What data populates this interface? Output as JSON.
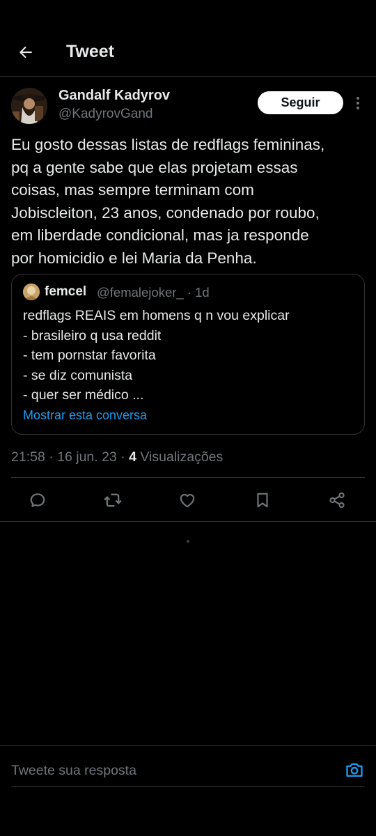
{
  "header": {
    "title": "Tweet",
    "back_icon": "arrow-left-icon"
  },
  "tweet": {
    "author_name": "Gandalf Kadyrov",
    "author_handle": "@KadyrovGand",
    "follow_label": "Seguir",
    "text": "Eu gosto dessas listas de redflags femininas,\npq a gente sabe que elas projetam essas\ncoisas, mas sempre terminam com\nJobiscleiton, 23 anos, condenado por roubo,\nem liberdade condicional, mas ja responde\npor homicidio e lei Maria da Penha.",
    "time": "21:58 · 16 jun. 23 · ",
    "views_count": "4",
    "views_label": " Visualizações"
  },
  "quote": {
    "author_name": "femcel",
    "author_handle": "@femalejoker_ · 1d",
    "text": "redflags REAIS em homens q n vou explicar\n- brasileiro q usa reddit\n- tem pornstar favorita\n- se diz comunista\n- quer ser médico ...",
    "link": "Mostrar esta conversa"
  },
  "actions": [
    {
      "icon": "reply-icon"
    },
    {
      "icon": "retweet-icon"
    },
    {
      "icon": "like-icon"
    },
    {
      "icon": "bookmark-icon"
    },
    {
      "icon": "share-icon"
    }
  ],
  "reply_bar": {
    "placeholder": "Tweete sua resposta",
    "icon": "camera-icon"
  },
  "colors": {
    "background": "#000000",
    "text": "#e7e9ea",
    "secondary": "#71767b",
    "accent": "#1d9bf0",
    "border": "#2f3336"
  }
}
